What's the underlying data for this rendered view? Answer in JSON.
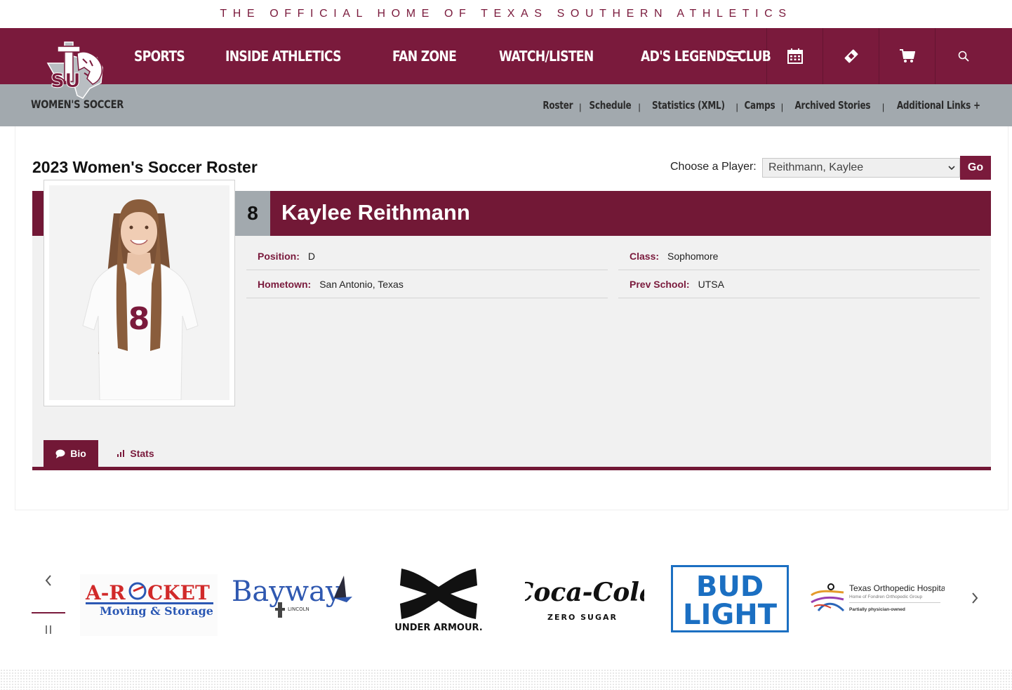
{
  "tagline": "THE OFFICIAL HOME OF TEXAS SOUTHERN ATHLETICS",
  "brand": {
    "primary": "#7a1a3c",
    "header_dark": "#721836",
    "subnav_gray": "#a2a9ae",
    "logo_text": "SU"
  },
  "nav": {
    "items": [
      "SPORTS",
      "INSIDE ATHLETICS",
      "FAN ZONE",
      "WATCH/LISTEN",
      "AD'S LEGENDS CLUB"
    ],
    "icons": [
      "menu-icon",
      "calendar-icon",
      "ticket-icon",
      "cart-icon",
      "search-icon"
    ]
  },
  "subnav": {
    "sport": "WOMEN'S SOCCER",
    "links": [
      "Roster",
      "Schedule",
      "Statistics (XML)",
      "Camps",
      "Archived Stories",
      "Additional Links +"
    ],
    "separator": "|"
  },
  "roster": {
    "title": "2023 Women's Soccer Roster",
    "chooser_label": "Choose a Player:",
    "chooser_value": "Reithmann, Kaylee",
    "go_label": "Go"
  },
  "player": {
    "number": "8",
    "name": "Kaylee Reithmann",
    "jersey_number_on_photo": "8",
    "fields": [
      {
        "key": "Position:",
        "value": "D"
      },
      {
        "key": "Class:",
        "value": "Sophomore"
      },
      {
        "key": "Hometown:",
        "value": "San Antonio, Texas"
      },
      {
        "key": "Prev School:",
        "value": "UTSA"
      }
    ]
  },
  "tabs": [
    {
      "label": "Bio",
      "icon": "speech-bubble-icon",
      "active": true
    },
    {
      "label": "Stats",
      "icon": "bar-chart-icon",
      "active": false
    }
  ],
  "sponsors": {
    "arocket": {
      "line1": "A-R",
      "line1b": "CKET",
      "line2": "Moving & Storage"
    },
    "bayway": {
      "name": "Bayway",
      "sub": "LINCOLN"
    },
    "underarmour": {
      "name": "UNDER ARMOUR."
    },
    "cocacola": {
      "name": "Coca-Cola",
      "sub": "ZERO SUGAR"
    },
    "budlight": {
      "line1": "BUD",
      "line2": "LIGHT"
    },
    "texasortho": {
      "name": "Texas Orthopedic Hospital",
      "sub": "Home of Fondren Orthopedic Group",
      "note": "Partially physician-owned"
    }
  }
}
